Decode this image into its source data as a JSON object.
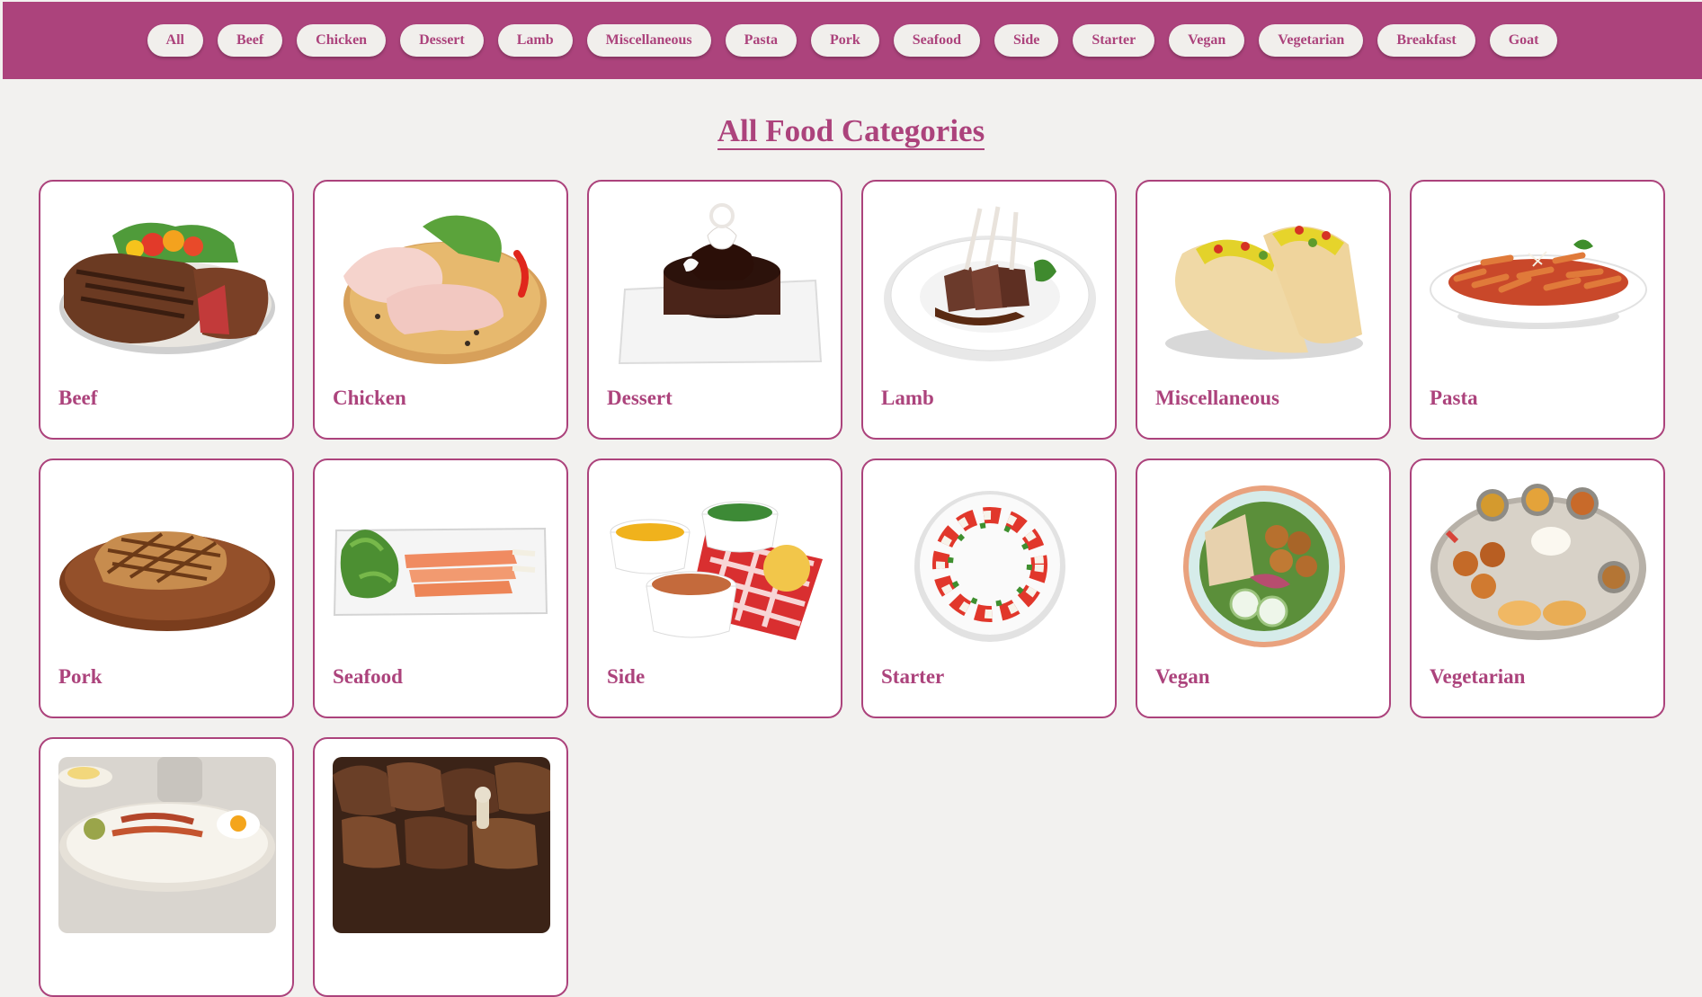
{
  "nav": {
    "items": [
      "All",
      "Beef",
      "Chicken",
      "Dessert",
      "Lamb",
      "Miscellaneous",
      "Pasta",
      "Pork",
      "Seafood",
      "Side",
      "Starter",
      "Vegan",
      "Vegetarian",
      "Breakfast",
      "Goat"
    ]
  },
  "page": {
    "title": "All Food Categories"
  },
  "categories": [
    {
      "name": "Beef",
      "image": "grilled-steak-image"
    },
    {
      "name": "Chicken",
      "image": "raw-chicken-legs-image"
    },
    {
      "name": "Dessert",
      "image": "chocolate-lava-cake-image"
    },
    {
      "name": "Lamb",
      "image": "lamb-chops-image"
    },
    {
      "name": "Miscellaneous",
      "image": "tacos-image"
    },
    {
      "name": "Pasta",
      "image": "penne-pasta-image"
    },
    {
      "name": "Pork",
      "image": "pork-chop-image"
    },
    {
      "name": "Seafood",
      "image": "salmon-plate-image"
    },
    {
      "name": "Side",
      "image": "side-dishes-image"
    },
    {
      "name": "Starter",
      "image": "caprese-salad-image"
    },
    {
      "name": "Vegan",
      "image": "falafel-bowl-image"
    },
    {
      "name": "Vegetarian",
      "image": "thali-platter-image"
    },
    {
      "name": "",
      "image": "breakfast-plate-image"
    },
    {
      "name": "",
      "image": "goat-curry-image"
    }
  ],
  "colors": {
    "accent": "#ac437c",
    "background": "#f2f1ef",
    "card": "#ffffff",
    "pill": "#f1efec"
  }
}
